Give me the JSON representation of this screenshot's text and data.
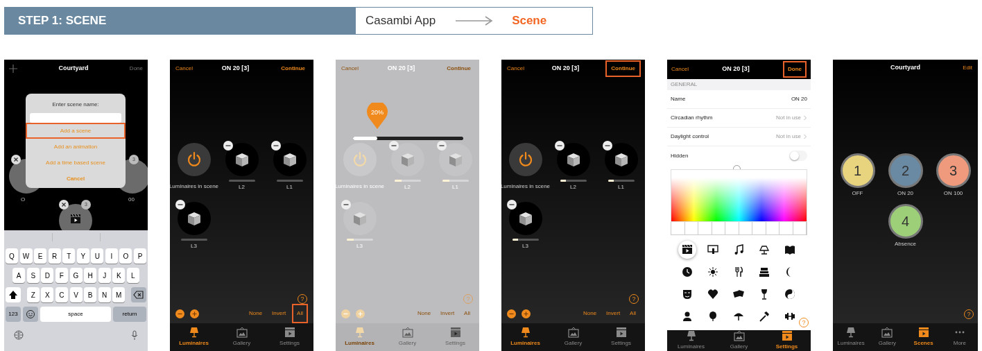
{
  "header": {
    "step": "STEP 1: SCENE",
    "app": "Casambi App",
    "target": "Scene"
  },
  "phones": [
    {
      "kind": "dialog",
      "nav": {
        "add_button": true,
        "title": "Courtyard",
        "right": "Done"
      },
      "behind": {
        "badges": [
          "3",
          "3"
        ],
        "labels": [
          "O",
          "00"
        ]
      },
      "dialog": {
        "prompt": "Enter scene name:",
        "options": [
          {
            "label": "Add a scene",
            "kind": "action",
            "highlighted": true
          },
          {
            "label": "Add an animation",
            "kind": "action",
            "highlighted": false
          },
          {
            "label": "Add a time based scene",
            "kind": "action",
            "highlighted": false
          },
          {
            "label": "Cancel",
            "kind": "cancel",
            "highlighted": false
          }
        ]
      },
      "keyboard": {
        "rows": [
          [
            "Q",
            "W",
            "E",
            "R",
            "T",
            "Y",
            "U",
            "I",
            "O",
            "P"
          ],
          [
            "A",
            "S",
            "D",
            "F",
            "G",
            "H",
            "J",
            "K",
            "L"
          ],
          [
            "Z",
            "X",
            "C",
            "V",
            "B",
            "N",
            "M"
          ]
        ],
        "keys": [
          "123",
          "space",
          "return"
        ]
      }
    },
    {
      "kind": "luminaires",
      "dimmed": false,
      "nav": {
        "left": "Cancel",
        "title": "ON 20 [3]",
        "right": "Continue",
        "right_highlighted": false
      },
      "power_label": "Luminaires in scene",
      "luminaires": [
        {
          "label": "L2",
          "level": 0
        },
        {
          "label": "L1",
          "level": 0
        },
        {
          "label": "L3",
          "level": 0
        }
      ],
      "help": "?",
      "actions": [
        {
          "label": "None",
          "highlighted": false
        },
        {
          "label": "Invert",
          "highlighted": false
        },
        {
          "label": "All",
          "highlighted": true
        }
      ],
      "tabs": [
        {
          "label": "Luminaires",
          "kind": "luminaires",
          "selected": true
        },
        {
          "label": "Gallery",
          "kind": "gallery",
          "selected": false
        },
        {
          "label": "Settings",
          "kind": "settings",
          "selected": false
        }
      ]
    },
    {
      "kind": "luminaires",
      "dimmed": true,
      "nav": {
        "left": "Cancel",
        "title": "ON 20 [3]",
        "right": "Continue",
        "right_highlighted": false
      },
      "popup": {
        "value": "20%",
        "level": 0.22
      },
      "power_label": "Luminaires in scene",
      "luminaires": [
        {
          "label": "L2",
          "level": 0.27
        },
        {
          "label": "L1",
          "level": 0.27
        },
        {
          "label": "L3",
          "level": 0.27
        }
      ],
      "help": "?",
      "actions": [
        {
          "label": "None",
          "highlighted": false
        },
        {
          "label": "Invert",
          "highlighted": false
        },
        {
          "label": "All",
          "highlighted": false
        }
      ],
      "tabs": [
        {
          "label": "Luminaires",
          "kind": "luminaires",
          "selected": true
        },
        {
          "label": "Gallery",
          "kind": "gallery",
          "selected": false
        },
        {
          "label": "Settings",
          "kind": "settings",
          "selected": false
        }
      ]
    },
    {
      "kind": "luminaires",
      "dimmed": false,
      "nav": {
        "left": "Cancel",
        "title": "ON 20 [3]",
        "right": "Continue",
        "right_highlighted": true
      },
      "power_label": "Luminaires in scene",
      "luminaires": [
        {
          "label": "L2",
          "level": 0.22
        },
        {
          "label": "L1",
          "level": 0.22
        },
        {
          "label": "L3",
          "level": 0.22
        }
      ],
      "help": "?",
      "actions": [
        {
          "label": "None",
          "highlighted": false
        },
        {
          "label": "Invert",
          "highlighted": false
        },
        {
          "label": "All",
          "highlighted": false
        }
      ],
      "tabs": [
        {
          "label": "Luminaires",
          "kind": "luminaires",
          "selected": true
        },
        {
          "label": "Gallery",
          "kind": "gallery",
          "selected": false
        },
        {
          "label": "Settings",
          "kind": "settings",
          "selected": false
        }
      ]
    },
    {
      "kind": "settings",
      "nav": {
        "left": "Cancel",
        "title": "ON 20 [3]",
        "right": "Done",
        "right_highlighted": true
      },
      "section": "GENERAL",
      "rows": [
        {
          "label": "Name",
          "value": "ON 20",
          "chevron": false
        },
        {
          "label": "Circadian rhythm",
          "value": "Not in use",
          "chevron": true
        },
        {
          "label": "Daylight control",
          "value": "Not in use",
          "chevron": true
        }
      ],
      "toggle": {
        "label": "Hidden",
        "on": false
      },
      "icons": [
        {
          "selected": true
        },
        {
          "selected": false
        },
        {
          "selected": false
        },
        {
          "selected": false
        },
        {
          "selected": false
        },
        {
          "selected": false
        },
        {
          "selected": false
        },
        {
          "selected": false
        },
        {
          "selected": false
        },
        {
          "selected": false
        },
        {
          "selected": false
        },
        {
          "selected": false
        },
        {
          "selected": false
        },
        {
          "selected": false
        },
        {
          "selected": false
        },
        {
          "selected": false
        },
        {
          "selected": false
        },
        {
          "selected": false
        },
        {
          "selected": false
        },
        {
          "selected": false
        }
      ],
      "help": "?",
      "tabs": [
        {
          "label": "Luminaires",
          "kind": "luminaires",
          "selected": false
        },
        {
          "label": "Gallery",
          "kind": "gallery",
          "selected": false
        },
        {
          "label": "Settings",
          "kind": "settings",
          "selected": true
        }
      ]
    },
    {
      "kind": "scenes",
      "nav": {
        "title": "Courtyard",
        "right": "Edit"
      },
      "scenes": [
        {
          "number": "1",
          "label": "OFF",
          "color": "#e8d47e"
        },
        {
          "number": "2",
          "label": "ON 20",
          "color": "#6a8aa4"
        },
        {
          "number": "3",
          "label": "ON 100",
          "color": "#ef997d"
        },
        {
          "number": "4",
          "label": "Absence",
          "color": "#9ccf78"
        }
      ],
      "help": "?",
      "tabs": [
        {
          "label": "Luminaires",
          "kind": "luminaires",
          "selected": false
        },
        {
          "label": "Gallery",
          "kind": "gallery",
          "selected": false
        },
        {
          "label": "Scenes",
          "kind": "settings",
          "selected": true
        },
        {
          "label": "More",
          "kind": "more",
          "selected": false
        }
      ]
    }
  ]
}
